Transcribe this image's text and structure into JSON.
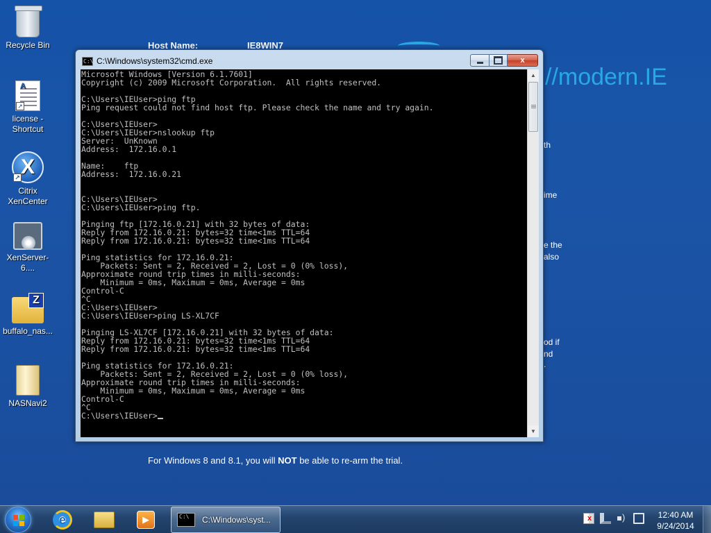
{
  "desktop": {
    "icons": [
      {
        "label": "Recycle Bin"
      },
      {
        "label": "license - Shortcut"
      },
      {
        "label": "Citrix XenCenter"
      },
      {
        "label": "XenServer-6...."
      },
      {
        "label": "buffalo_nas..."
      },
      {
        "label": "NASNavi2"
      }
    ],
    "background": {
      "host_label": "Host Name:",
      "host_value": "IE8WIN7",
      "brand": "//modern.IE",
      "fragments": [
        "th",
        "ime",
        "e the",
        "also",
        "od if",
        "nd",
        "."
      ],
      "rearm_prefix": "For Windows 8 and 8.1, you will ",
      "rearm_bold": "NOT",
      "rearm_suffix": " be able to re-arm the trial."
    }
  },
  "cmd_window": {
    "title": "C:\\Windows\\system32\\cmd.exe",
    "title_icon": "C:\\",
    "close_label": "x",
    "lines": [
      "Microsoft Windows [Version 6.1.7601]",
      "Copyright (c) 2009 Microsoft Corporation.  All rights reserved.",
      "",
      "C:\\Users\\IEUser>ping ftp",
      "Ping request could not find host ftp. Please check the name and try again.",
      "",
      "C:\\Users\\IEUser>",
      "C:\\Users\\IEUser>nslookup ftp",
      "Server:  UnKnown",
      "Address:  172.16.0.1",
      "",
      "Name:    ftp",
      "Address:  172.16.0.21",
      "",
      "",
      "C:\\Users\\IEUser>",
      "C:\\Users\\IEUser>ping ftp.",
      "",
      "Pinging ftp [172.16.0.21] with 32 bytes of data:",
      "Reply from 172.16.0.21: bytes=32 time<1ms TTL=64",
      "Reply from 172.16.0.21: bytes=32 time<1ms TTL=64",
      "",
      "Ping statistics for 172.16.0.21:",
      "    Packets: Sent = 2, Received = 2, Lost = 0 (0% loss),",
      "Approximate round trip times in milli-seconds:",
      "    Minimum = 0ms, Maximum = 0ms, Average = 0ms",
      "Control-C",
      "^C",
      "C:\\Users\\IEUser>",
      "C:\\Users\\IEUser>ping LS-XL7CF",
      "",
      "Pinging LS-XL7CF [172.16.0.21] with 32 bytes of data:",
      "Reply from 172.16.0.21: bytes=32 time<1ms TTL=64",
      "Reply from 172.16.0.21: bytes=32 time<1ms TTL=64",
      "",
      "Ping statistics for 172.16.0.21:",
      "    Packets: Sent = 2, Received = 2, Lost = 0 (0% loss),",
      "Approximate round trip times in milli-seconds:",
      "    Minimum = 0ms, Maximum = 0ms, Average = 0ms",
      "Control-C",
      "^C"
    ],
    "prompt": "C:\\Users\\IEUser>"
  },
  "taskbar": {
    "task_label": "C:\\Windows\\syst...",
    "task_icon": "C:\\",
    "clock_time": "12:40 AM",
    "clock_date": "9/24/2014",
    "pinned": [
      "internet-explorer-icon",
      "windows-explorer-icon",
      "media-player-icon"
    ]
  },
  "colors": {
    "desktop_blue": "#1b54a6",
    "brand_blue": "#29a9e3",
    "console_text": "#c0c0c0",
    "console_bg": "#000000"
  }
}
